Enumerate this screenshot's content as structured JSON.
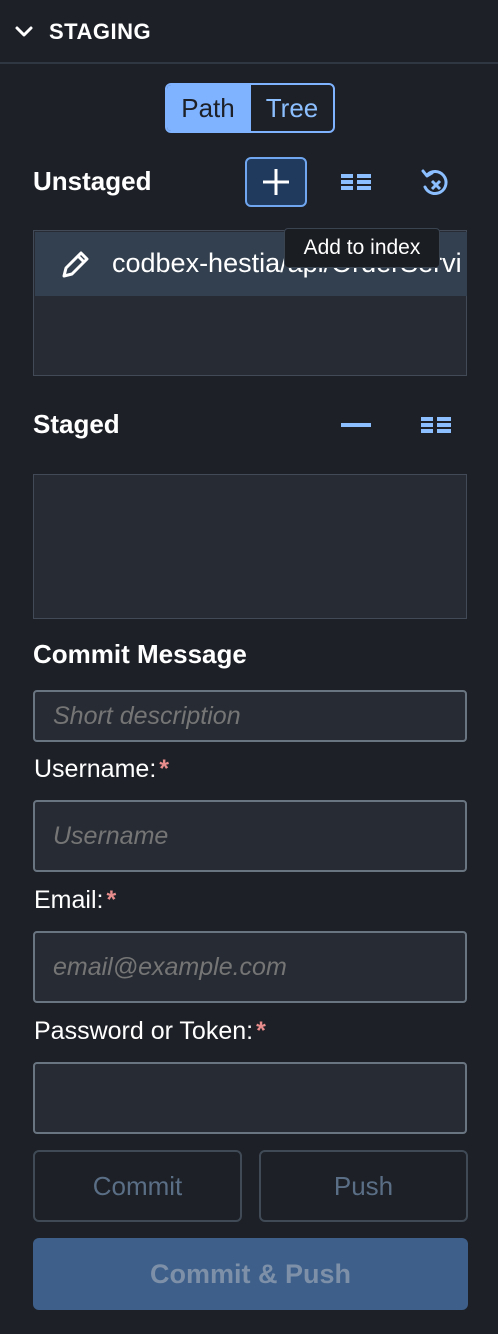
{
  "header": {
    "title": "STAGING",
    "icon": "chevron-down-icon"
  },
  "view_toggle": {
    "options": [
      "Path",
      "Tree"
    ],
    "selected": "Path"
  },
  "unstaged": {
    "title": "Unstaged",
    "actions": [
      "add-icon",
      "list-view-icon",
      "discard-icon"
    ],
    "files": [
      {
        "icon": "pencil-icon",
        "name": "codbex-hestia/api/OrderServi"
      }
    ]
  },
  "tooltip": {
    "text": "Add to index"
  },
  "staged": {
    "title": "Staged",
    "actions": [
      "remove-icon",
      "list-view-icon"
    ],
    "files": []
  },
  "commit": {
    "title": "Commit Message",
    "message_placeholder": "Short description",
    "username_label": "Username:",
    "username_placeholder": "Username",
    "email_label": "Email:",
    "email_placeholder": "email@example.com",
    "password_label": "Password or Token:",
    "password_placeholder": "",
    "required_mark": "*"
  },
  "buttons": {
    "commit": "Commit",
    "push": "Push",
    "commit_push": "Commit & Push"
  },
  "colors": {
    "background": "#1d2026",
    "accent": "#7fb2ff",
    "required": "#e88c8c",
    "primary_disabled": "#3d5f8a"
  }
}
